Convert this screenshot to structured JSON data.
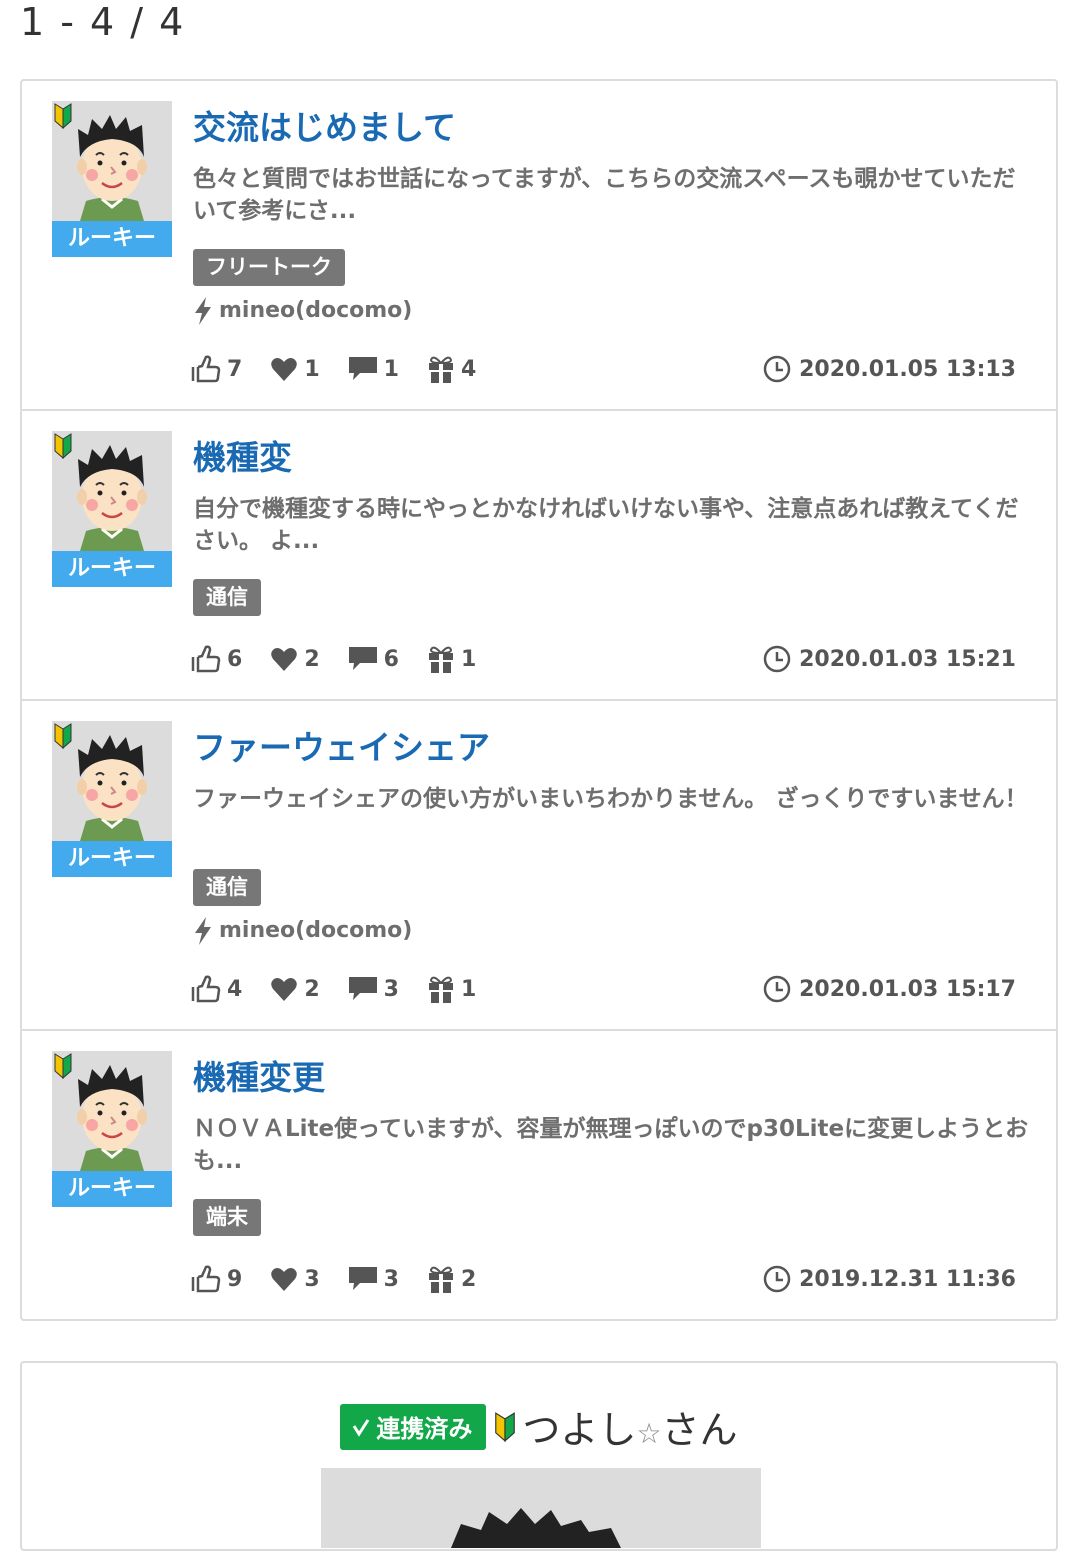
{
  "result_count": "1 - 4 / 4",
  "posts": [
    {
      "title": "交流はじめまして",
      "excerpt": "色々と質問ではお世話になってますが、こちらの交流スペースも覗かせていただいて参考にさ...",
      "rank": "ルーキー",
      "tag": "フリートーク",
      "carrier": "mineo(docomo)",
      "likes": "7",
      "hearts": "1",
      "comments": "1",
      "gifts": "4",
      "date": "2020.01.05 13:13"
    },
    {
      "title": "機種変",
      "excerpt": "自分で機種変する時にやっとかなければいけない事や、注意点あれば教えてください。 よ...",
      "rank": "ルーキー",
      "tag": "通信",
      "likes": "6",
      "hearts": "2",
      "comments": "6",
      "gifts": "1",
      "date": "2020.01.03 15:21"
    },
    {
      "title": "ファーウェイシェア",
      "excerpt": "ファーウェイシェアの使い方がいまいちわかりません。 ざっくりですいません！",
      "rank": "ルーキー",
      "tag": "通信",
      "carrier": "mineo(docomo)",
      "likes": "4",
      "hearts": "2",
      "comments": "3",
      "gifts": "1",
      "date": "2020.01.03 15:17"
    },
    {
      "title": "機種変更",
      "excerpt": "ＮＯＶＡLite使っていますが、容量が無理っぽいのでp30Liteに変更しようとおも...",
      "rank": "ルーキー",
      "tag": "端末",
      "likes": "9",
      "hearts": "3",
      "comments": "3",
      "gifts": "2",
      "date": "2019.12.31 11:36"
    }
  ],
  "profile": {
    "linked_label": "連携済み",
    "name": "つよし",
    "star": "☆",
    "suffix": "さん"
  },
  "colors": {
    "title": "#1a6ab3",
    "rank_badge": "#44aaee",
    "tag": "#777777",
    "linked_badge": "#12a84a"
  },
  "icons": [
    "thumbs-up-icon",
    "heart-icon",
    "comment-icon",
    "gift-icon",
    "clock-icon",
    "bolt-icon",
    "beginner-leaf-icon"
  ]
}
